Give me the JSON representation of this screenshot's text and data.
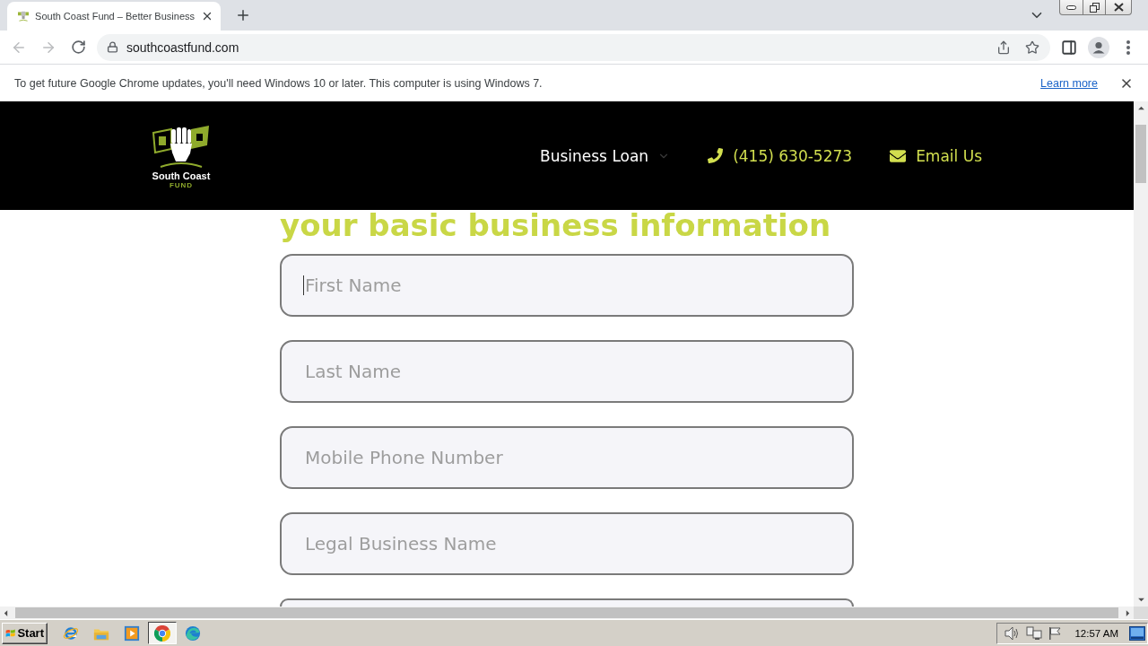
{
  "browser": {
    "tabs": [
      {
        "title": "South Coast Fund – Better Business",
        "selected": true
      }
    ],
    "address": "southcoastfund.com",
    "infobar": {
      "message": "To get future Google Chrome updates, you'll need Windows 10 or later. This computer is using Windows 7.",
      "link": "Learn more"
    }
  },
  "site_header": {
    "logo": {
      "name": "South Coast",
      "tagline": "FUND"
    },
    "nav": [
      {
        "kind": "dropdown",
        "label": "Business Loan"
      },
      {
        "kind": "phone",
        "label": "(415) 630-5273"
      },
      {
        "kind": "email",
        "label": "Email Us"
      }
    ]
  },
  "form": {
    "heading": "your basic business information",
    "fields": [
      {
        "placeholder": "First Name",
        "focused": true
      },
      {
        "placeholder": "Last Name",
        "focused": false
      },
      {
        "placeholder": "Mobile Phone Number",
        "focused": false
      },
      {
        "placeholder": "Legal Business Name",
        "focused": false
      },
      {
        "focused": false
      }
    ]
  },
  "taskbar": {
    "start": "Start",
    "apps": [
      {
        "kind": "ie",
        "selected": false
      },
      {
        "kind": "explorer",
        "selected": false
      },
      {
        "kind": "media",
        "selected": false
      },
      {
        "kind": "chrome",
        "selected": true
      },
      {
        "kind": "edge",
        "selected": false
      }
    ],
    "clock": "12:57 AM"
  }
}
